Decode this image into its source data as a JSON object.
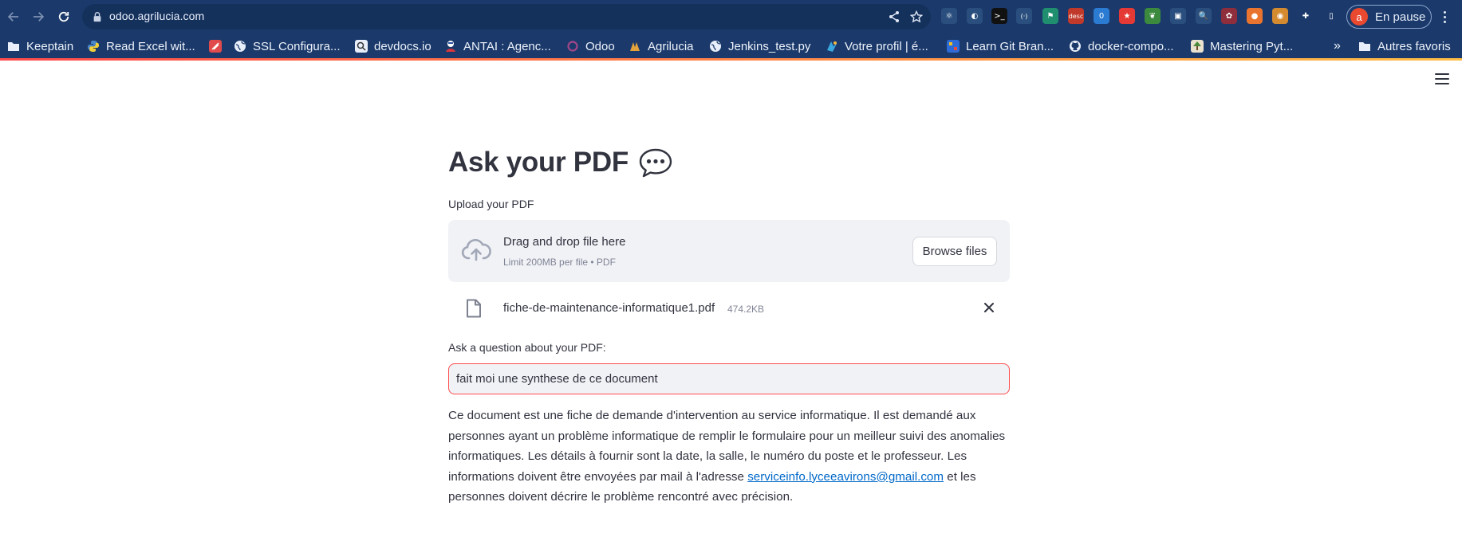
{
  "browser": {
    "url": "odoo.agrilucia.com",
    "profile_initial": "a",
    "profile_status": "En pause",
    "extensions": [
      {
        "name": "react-icon",
        "color": "#2a4f7e",
        "glyph": "⚛"
      },
      {
        "name": "half-circle-icon",
        "color": "#2a4f7e",
        "glyph": "◐"
      },
      {
        "name": "terminal-icon",
        "color": "#111111",
        "glyph": ">_"
      },
      {
        "name": "brackets-icon",
        "color": "#2a4f7e",
        "glyph": "(·)"
      },
      {
        "name": "green-flag-icon",
        "color": "#1f8f6f",
        "glyph": "⚑"
      },
      {
        "name": "desc-icon",
        "color": "#c0392b",
        "glyph": "desc"
      },
      {
        "name": "badge-zero-icon",
        "color": "#2b7bd3",
        "glyph": "0"
      },
      {
        "name": "red-star-icon",
        "color": "#e53935",
        "glyph": "★"
      },
      {
        "name": "leaf-icon",
        "color": "#3b8a3e",
        "glyph": "❦"
      },
      {
        "name": "screen-icon",
        "color": "#2a4f7e",
        "glyph": "▣"
      },
      {
        "name": "magnifier-icon",
        "color": "#2a4f7e",
        "glyph": "🔍"
      },
      {
        "name": "wreath-icon",
        "color": "#8e2d3b",
        "glyph": "✿"
      },
      {
        "name": "flame-icon",
        "color": "#e8742f",
        "glyph": "●"
      },
      {
        "name": "cookie-icon",
        "color": "#d48b2f",
        "glyph": "◉"
      },
      {
        "name": "puzzle-icon",
        "color": "#1b3a6b",
        "glyph": "✚"
      },
      {
        "name": "sidepanel-icon",
        "color": "#1b3a6b",
        "glyph": "▯"
      }
    ],
    "bookmarks": [
      {
        "label": "Keeptain",
        "icon": "folder-icon"
      },
      {
        "label": "Read Excel wit...",
        "icon": "python-icon"
      },
      {
        "label": "",
        "icon": "red-block-icon"
      },
      {
        "label": "SSL Configura...",
        "icon": "globe-icon"
      },
      {
        "label": "devdocs.io",
        "icon": "devdocs-icon"
      },
      {
        "label": "ANTAI : Agenc...",
        "icon": "antai-icon"
      },
      {
        "label": "Odoo",
        "icon": "odoo-icon"
      },
      {
        "label": "Agrilucia",
        "icon": "agrilucia-icon"
      },
      {
        "label": "Jenkins_test.py",
        "icon": "globe-icon"
      },
      {
        "label": "Votre profil | é...",
        "icon": "profile-icon"
      },
      {
        "label": "Learn Git Bran...",
        "icon": "git-icon"
      },
      {
        "label": "docker-compo...",
        "icon": "github-icon"
      },
      {
        "label": "Mastering Pyt...",
        "icon": "book-icon"
      }
    ],
    "overflow_label": "»",
    "other_bookmarks": "Autres favoris"
  },
  "app": {
    "title": "Ask your PDF",
    "title_icon": "speech-bubble-icon",
    "upload_label": "Upload your PDF",
    "dropzone": {
      "title": "Drag and drop file here",
      "subtitle": "Limit 200MB per file • PDF",
      "browse_label": "Browse files"
    },
    "uploaded_file": {
      "name": "fiche-de-maintenance-informatique1.pdf",
      "size": "474.2KB"
    },
    "question_label": "Ask a question about your PDF:",
    "question_value": "fait moi une synthese de ce document",
    "answer": {
      "before_link": "Ce document est une fiche de demande d'intervention au service informatique. Il est demandé aux personnes ayant un problème informatique de remplir le formulaire pour un meilleur suivi des anomalies informatiques. Les détails à fournir sont la date, la salle, le numéro du poste et le professeur. Les informations doivent être envoyées par mail à l'adresse ",
      "link": "serviceinfo.lyceeavirons@gmail.com",
      "after_link": " et les personnes doivent décrire le problème rencontré avec précision."
    },
    "colors": {
      "primary": "#ff4b4b",
      "text": "#31333f",
      "link": "#0068c9",
      "chrome": "#1b3a6b"
    }
  }
}
